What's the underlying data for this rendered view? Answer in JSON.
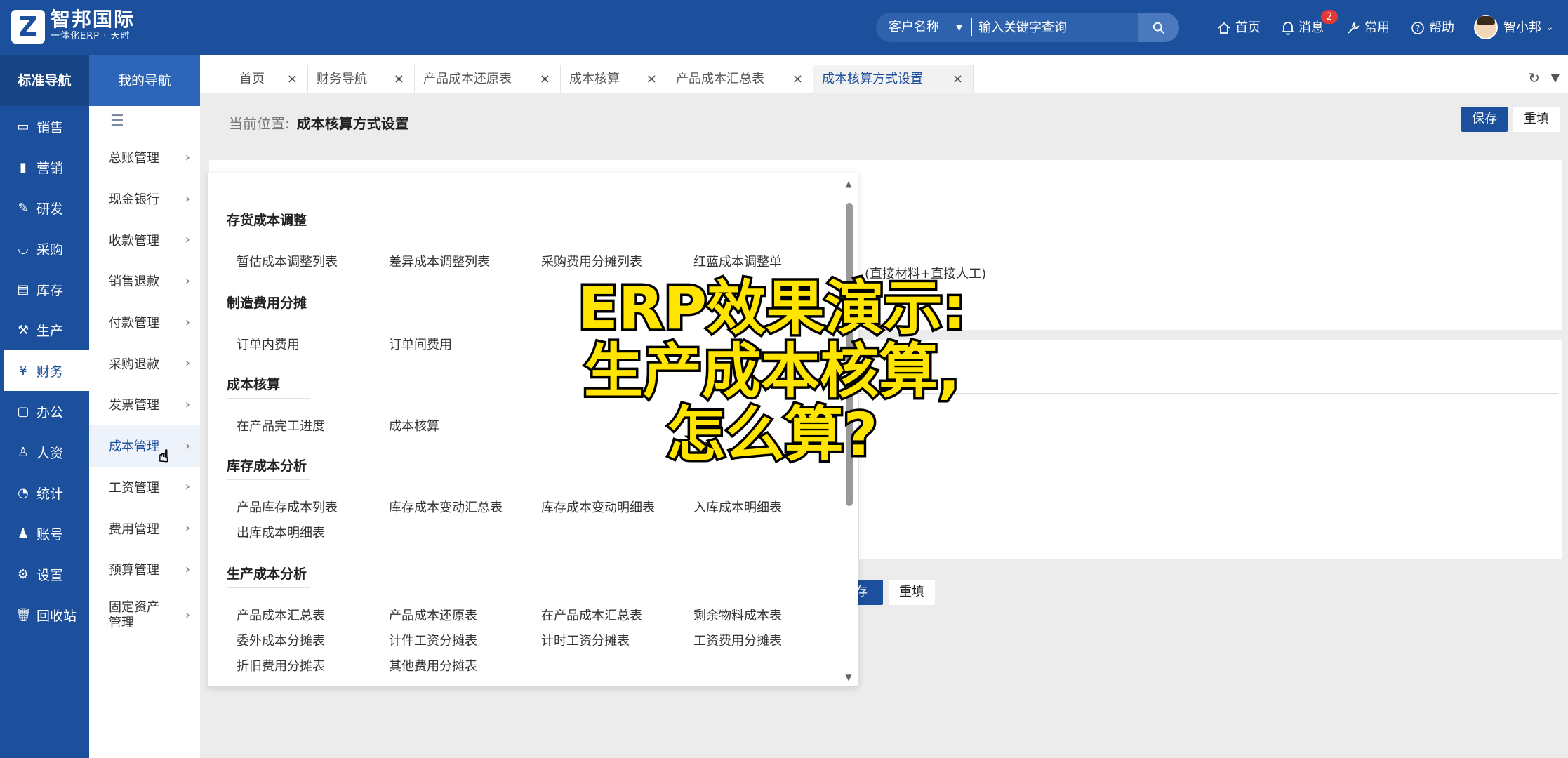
{
  "app": {
    "logo_letter": "Z",
    "brand_name": "智邦国际",
    "brand_slogan": "一体化ERP · 天时"
  },
  "search": {
    "scope": "客户名称",
    "placeholder": "输入关键字查询"
  },
  "topnav": {
    "home": "首页",
    "messages": "消息",
    "messages_badge": "2",
    "common": "常用",
    "help": "帮助",
    "user": "智小邦"
  },
  "leftnav": {
    "title": "标准导航",
    "items": [
      {
        "label": "销售",
        "icon": "chat-icon"
      },
      {
        "label": "营销",
        "icon": "bar-chart-icon"
      },
      {
        "label": "研发",
        "icon": "pen-icon"
      },
      {
        "label": "采购",
        "icon": "basket-icon"
      },
      {
        "label": "库存",
        "icon": "inventory-icon"
      },
      {
        "label": "生产",
        "icon": "factory-icon"
      },
      {
        "label": "财务",
        "icon": "yen-icon"
      },
      {
        "label": "办公",
        "icon": "briefcase-icon"
      },
      {
        "label": "人资",
        "icon": "person-icon"
      },
      {
        "label": "统计",
        "icon": "pie-chart-icon"
      },
      {
        "label": "账号",
        "icon": "user-icon"
      },
      {
        "label": "设置",
        "icon": "gear-icon"
      },
      {
        "label": "回收站",
        "icon": "trash-icon"
      }
    ],
    "active": "财务"
  },
  "subnav": {
    "title": "我的导航",
    "items": [
      {
        "label": "总账管理"
      },
      {
        "label": "现金银行"
      },
      {
        "label": "收款管理"
      },
      {
        "label": "销售退款"
      },
      {
        "label": "付款管理"
      },
      {
        "label": "采购退款"
      },
      {
        "label": "发票管理"
      },
      {
        "label": "成本管理"
      },
      {
        "label": "工资管理"
      },
      {
        "label": "费用管理"
      },
      {
        "label": "预算管理"
      },
      {
        "label": "固定资产管理"
      }
    ],
    "active": "成本管理"
  },
  "tabs": [
    {
      "label": "首页"
    },
    {
      "label": "财务导航"
    },
    {
      "label": "产品成本还原表"
    },
    {
      "label": "成本核算"
    },
    {
      "label": "产品成本汇总表"
    },
    {
      "label": "成本核算方式设置"
    }
  ],
  "active_tab": "成本核算方式设置",
  "page": {
    "crumb_label": "当前位置:",
    "crumb_value": "成本核算方式设置",
    "save": "保存",
    "reset": "重填",
    "formula": "(直接材料+直接人工)",
    "save_bottom": "存",
    "reset_bottom": "重填"
  },
  "dropdown": {
    "groups": [
      {
        "title": "存货成本调整",
        "links": [
          "暂估成本调整列表",
          "差异成本调整列表",
          "采购费用分摊列表",
          "红蓝成本调整单"
        ]
      },
      {
        "title": "制造费用分摊",
        "links": [
          "订单内费用",
          "订单间费用"
        ]
      },
      {
        "title": "成本核算",
        "links": [
          "在产品完工进度",
          "成本核算"
        ]
      },
      {
        "title": "库存成本分析",
        "links": [
          "产品库存成本列表",
          "库存成本变动汇总表",
          "库存成本变动明细表",
          "入库成本明细表",
          "出库成本明细表"
        ]
      },
      {
        "title": "生产成本分析",
        "links": [
          "产品成本汇总表",
          "产品成本还原表",
          "在产品成本汇总表",
          "剩余物料成本表",
          "委外成本分摊表",
          "计件工资分摊表",
          "计时工资分摊表",
          "工资费用分摊表",
          "折旧费用分摊表",
          "其他费用分摊表"
        ]
      }
    ]
  },
  "overlay": {
    "line1": "ERP效果演示:",
    "line2": "生产成本核算,",
    "line3": "怎么算?"
  },
  "colors": {
    "brand": "#1c4f9c",
    "overlay_fill": "#ffe400",
    "badge": "#e53935"
  }
}
